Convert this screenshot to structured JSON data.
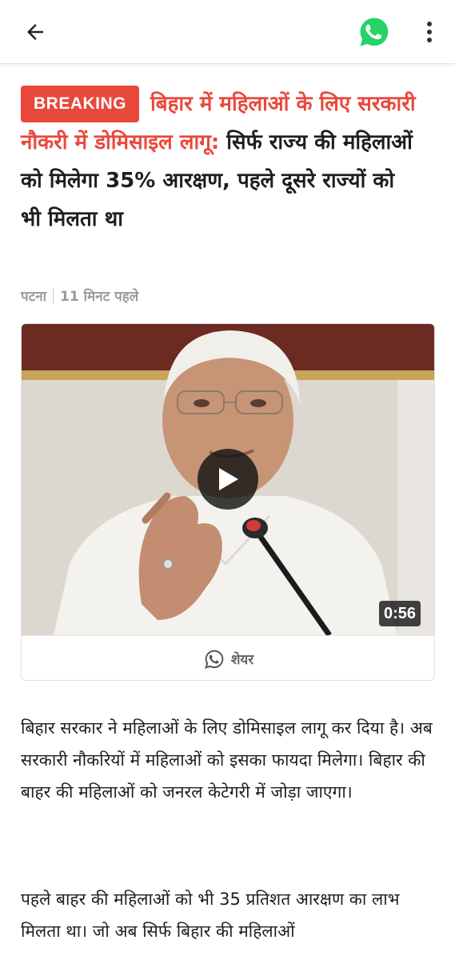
{
  "header": {
    "back_icon": "arrow-left-icon",
    "whatsapp_icon": "whatsapp-icon",
    "whatsapp_color": "#25d366",
    "menu_icon": "more-vertical-icon"
  },
  "article": {
    "badge": "BREAKING",
    "badge_color": "#e9483d",
    "title_highlight": "बिहार में महिलाओं के लिए सरकारी नौकरी में डोमिसाइल लागू:",
    "title_rest": "सिर्फ राज्य की महिलाओं को मिलेगा 35% आरक्षण, पहले दूसरे राज्यों को भी मिलता था",
    "location": "पटना",
    "time": "11 मिनट पहले",
    "video": {
      "duration": "0:56",
      "play_icon": "play-icon",
      "share_label": "शेयर",
      "share_icon": "whatsapp-icon"
    },
    "paragraphs": [
      "बिहार सरकार ने महिलाओं के लिए डोमिसाइल लागू कर दिया है। अब सरकारी नौकरियों में महिलाओं को इसका फायदा मिलेगा। बिहार की बाहर की महिलाओं को जनरल केटेगरी में जोड़ा जाएगा।",
      "पहले बाहर की महिलाओं को भी 35 प्रतिशत आरक्षण का लाभ मिलता था। जो अब सिर्फ बिहार की महिलाओं"
    ]
  }
}
